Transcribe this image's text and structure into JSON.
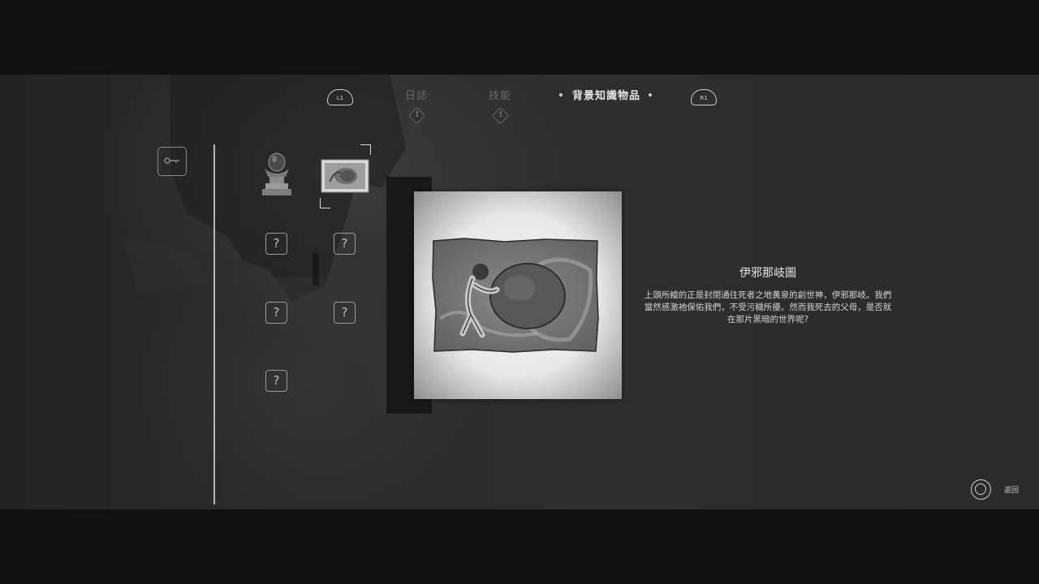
{
  "tabs": {
    "left_shoulder": "L1",
    "right_shoulder": "R1",
    "items": [
      {
        "label": "日誌",
        "state": "inactive",
        "has_alert": true
      },
      {
        "label": "技能",
        "state": "inactive",
        "has_alert": true
      },
      {
        "label": "背景知識物品",
        "state": "active",
        "has_alert": false
      }
    ],
    "alert_glyph": "!"
  },
  "category": {
    "icon": "key-icon"
  },
  "inventory": {
    "items": [
      {
        "name": "crystal-orb-statue",
        "discovered": true
      },
      {
        "name": "izanami-scroll",
        "discovered": true,
        "selected": true
      },
      {
        "name": "unknown",
        "discovered": false,
        "glyph": "?"
      },
      {
        "name": "unknown",
        "discovered": false,
        "glyph": "?"
      },
      {
        "name": "unknown",
        "discovered": false,
        "glyph": "?"
      },
      {
        "name": "unknown",
        "discovered": false,
        "glyph": "?"
      },
      {
        "name": "unknown",
        "discovered": false,
        "glyph": "?"
      }
    ]
  },
  "detail": {
    "title": "伊邪那岐圖",
    "description": "上頭所繪的正是封閉通往死者之地黃泉的創世神，伊邪那岐。我們當然感激祂保佑我們，不受污穢所擾。然而我死去的父母，是否就在那片黑暗的世界呢?"
  },
  "footer": {
    "back_label": "返回",
    "back_icon": "circle-button-icon"
  },
  "colors": {
    "background": "#2a2a2a",
    "letterbox": "#111111",
    "accent": "#e6e6e6"
  }
}
